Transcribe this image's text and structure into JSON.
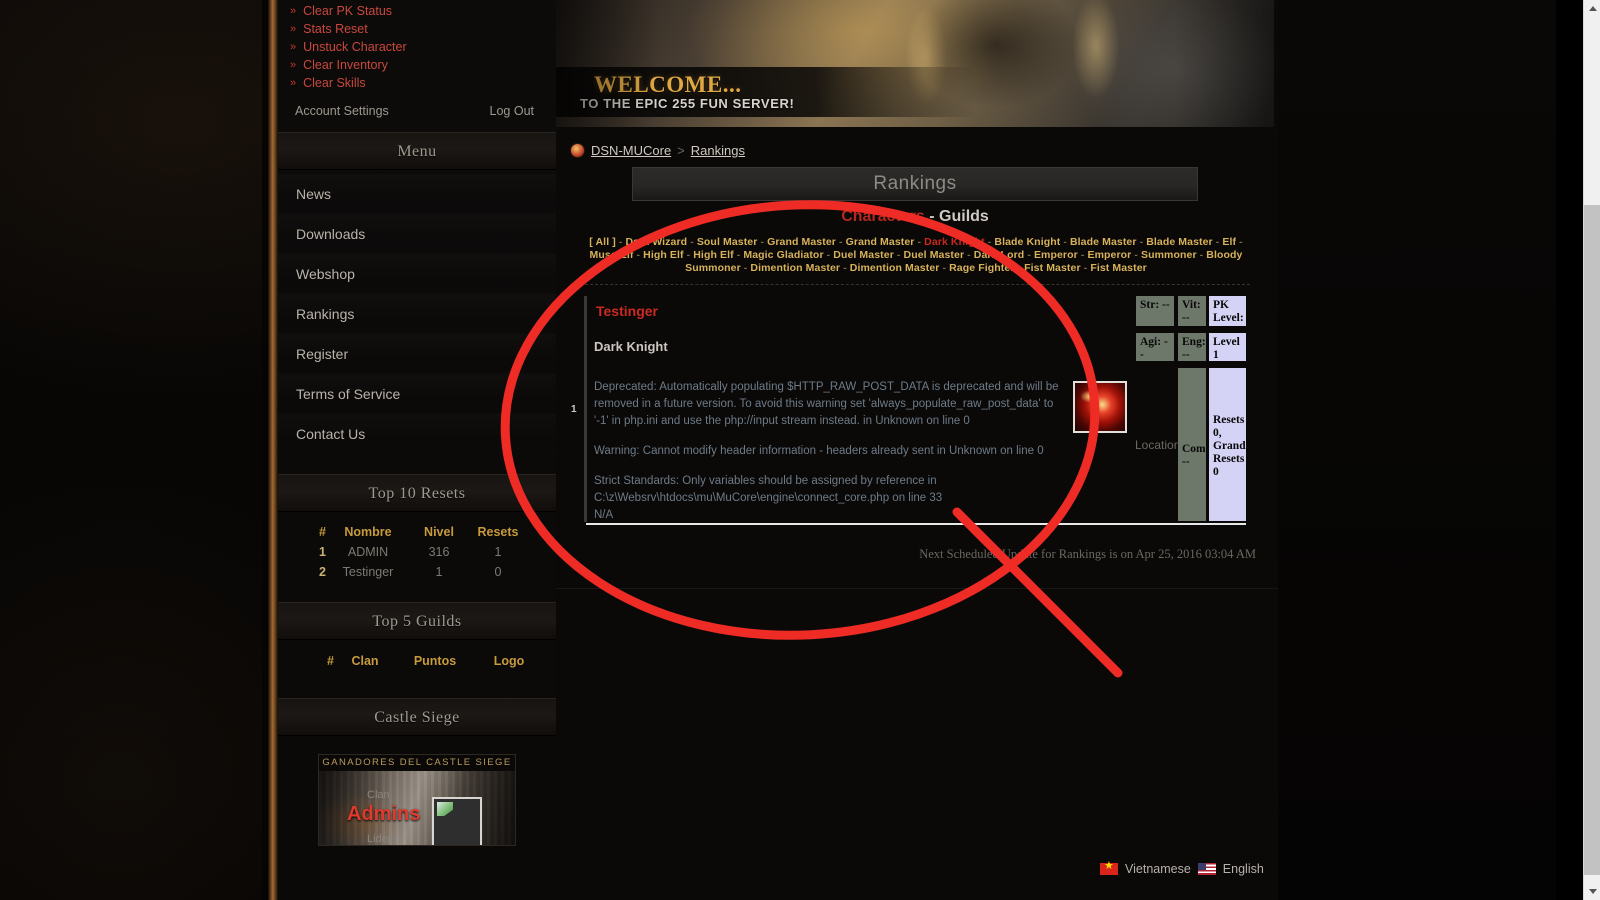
{
  "account_actions": [
    {
      "label": "Clear PK Status"
    },
    {
      "label": "Stats Reset"
    },
    {
      "label": "Unstuck Character"
    },
    {
      "label": "Clear Inventory"
    },
    {
      "label": "Clear Skills"
    }
  ],
  "account_footer": {
    "settings_label": "Account Settings",
    "logout_label": "Log Out"
  },
  "sidebar": {
    "menu_header": "Menu",
    "menu_items": [
      {
        "label": "News"
      },
      {
        "label": "Downloads"
      },
      {
        "label": "Webshop"
      },
      {
        "label": "Rankings"
      },
      {
        "label": "Register"
      },
      {
        "label": "Terms of Service"
      },
      {
        "label": "Contact Us"
      }
    ],
    "top_resets": {
      "header": "Top 10 Resets",
      "columns": [
        "#",
        "Nombre",
        "Nivel",
        "Resets"
      ],
      "rows": [
        {
          "rank": "1",
          "name": "ADMIN",
          "level": "316",
          "resets": "1"
        },
        {
          "rank": "2",
          "name": "Testinger",
          "level": "1",
          "resets": "0"
        }
      ]
    },
    "top_guilds": {
      "header": "Top 5 Guilds",
      "columns": [
        "#",
        "Clan",
        "Puntos",
        "Logo"
      ],
      "rows": []
    },
    "castle_siege": {
      "header": "Castle Siege",
      "banner_title": "GANADORES DEL CASTLE SIEGE",
      "clan_label": "Clan",
      "clan_name": "Admins",
      "leader_label": "Lider"
    }
  },
  "banner": {
    "welcome": "WELCOME...",
    "subtitle": "TO THE EPIC 255 FUN SERVER!"
  },
  "breadcrumb": {
    "home": "DSN-MUCore",
    "separator": ">",
    "current": "Rankings"
  },
  "page": {
    "title": "Rankings",
    "tabs": {
      "characters": "Characters",
      "separator": "-",
      "guilds": "Guilds"
    },
    "class_filters": [
      "[ All ]",
      "Dark Wizard",
      "Soul Master",
      "Grand Master",
      "Grand Master",
      "Dark Knight",
      "Blade Knight",
      "Blade Master",
      "Blade Master",
      "Elf",
      "Muse Elf",
      "High Elf",
      "High Elf",
      "Magic Gladiator",
      "Duel Master",
      "Duel Master",
      "Dark Lord",
      "Emperor",
      "Emperor",
      "Summoner",
      "Bloody Summoner",
      "Dimention Master",
      "Dimention Master",
      "Rage Fighter",
      "Fist Master",
      "Fist Master"
    ],
    "selected_class": "Dark Knight"
  },
  "character": {
    "rank": "1",
    "name": "Testinger",
    "class": "Dark Knight",
    "location_label": "Location",
    "location_value": "N/A",
    "stats": {
      "str": "Str: --",
      "vit": "Vit: --",
      "agi": "Agi: --",
      "eng": "Eng: --",
      "com": "Com: --",
      "pk_level": "PK Level: Hero",
      "level": "Level 1",
      "resets": "Resets 0, Grand Resets 0"
    },
    "errors": [
      "Deprecated: Automatically populating $HTTP_RAW_POST_DATA is deprecated and will be removed in a future version. To avoid this warning set 'always_populate_raw_post_data' to '-1' in php.ini and use the php://input stream instead. in Unknown on line 0",
      "Warning: Cannot modify header information - headers already sent in Unknown on line 0",
      "Strict Standards: Only variables should be assigned by reference in C:\\z\\Websrv\\htdocs\\mu\\MuCore\\engine\\connect_core.php on line 33"
    ]
  },
  "footer": {
    "next_update": "Next Scheduled Update for Rankings is on Apr 25, 2016 03:04 AM"
  },
  "languages": [
    {
      "label": "Vietnamese",
      "icon": "flag-vietnam-icon"
    },
    {
      "label": "English",
      "icon": "flag-usa-icon"
    }
  ],
  "colors": {
    "accent_red": "#cc2a20",
    "gold": "#d8b25a",
    "annotation_red": "#ee2b24"
  }
}
